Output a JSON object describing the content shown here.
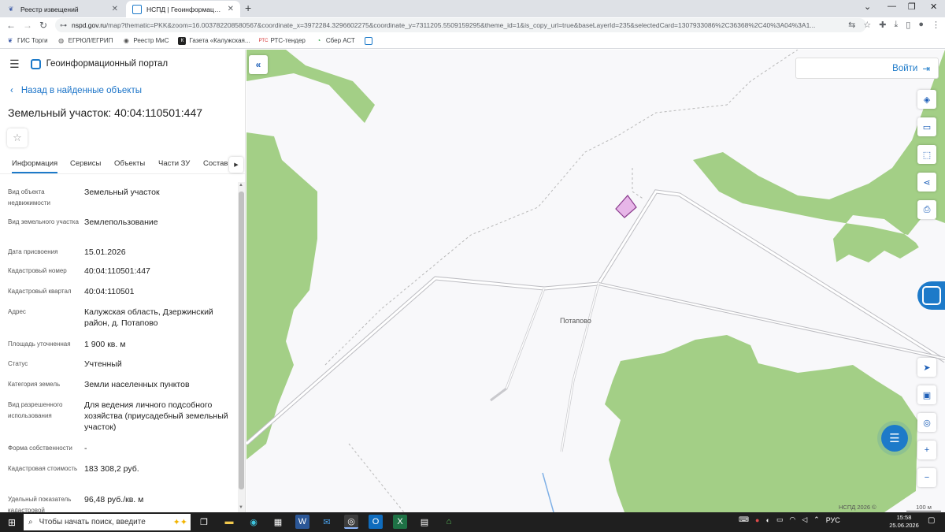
{
  "browser": {
    "tabs": [
      {
        "title": "Реестр извещений",
        "active": false
      },
      {
        "title": "НСПД | Геоинформационный п",
        "active": true
      }
    ],
    "url_host": "nspd.gov.ru",
    "url_path": "/map?thematic=PKK&zoom=16.003782208580567&coordinate_x=3972284.3296602275&coordinate_y=7311205.5509159295&theme_id=1&is_copy_url=true&baseLayerId=235&selectedCard=1307933086%2C36368%2C40%3A04%3A1...",
    "bookmarks": [
      {
        "label": "ГИС Торги",
        "icon": "gis-torgi-icon"
      },
      {
        "label": "ЕГРЮЛ/ЕГРИП",
        "icon": "egrul-icon"
      },
      {
        "label": "Реестр МиС",
        "icon": "registry-icon"
      },
      {
        "label": "Газета «Калужская...",
        "icon": "newspaper-icon"
      },
      {
        "label": "РТС-тендер",
        "icon": "rts-icon"
      },
      {
        "label": "Сбер АСТ",
        "icon": "sber-icon"
      }
    ]
  },
  "panel": {
    "portal_title": "Геоинформационный портал",
    "back_label": "Назад в найденные объекты",
    "title": "Земельный участок: 40:04:110501:447",
    "tabs": [
      "Информация",
      "Сервисы",
      "Объекты",
      "Части ЗУ",
      "Состав"
    ],
    "properties": [
      {
        "label": "Вид объекта недвижимости",
        "value": "Земельный участок"
      },
      {
        "label": "Вид земельного участка",
        "value": "Землепользование"
      },
      {
        "label": "Дата присвоения",
        "value": "15.01.2026"
      },
      {
        "label": "Кадастровый номер",
        "value": "40:04:110501:447"
      },
      {
        "label": "Кадастровый квартал",
        "value": "40:04:110501"
      },
      {
        "label": "Адрес",
        "value": "Калужская область, Дзержинский район, д. Потапово"
      },
      {
        "label": "Площадь уточненная",
        "value": "1 900 кв. м"
      },
      {
        "label": "Статус",
        "value": "Учтенный"
      },
      {
        "label": "Категория земель",
        "value": "Земли населенных пунктов"
      },
      {
        "label": "Вид разрешенного использования",
        "value": "Для ведения личного подсобного хозяйства (приусадебный земельный участок)"
      },
      {
        "label": "Форма собственности",
        "value": "-"
      },
      {
        "label": "Кадастровая стоимость",
        "value": "183 308,2 руб."
      },
      {
        "label": "Удельный показатель кадастровой",
        "value": "96,48 руб./кв. м"
      }
    ]
  },
  "map": {
    "login_label": "Войти",
    "place_label": "Потапово",
    "attribution": "НСПД 2026 ©",
    "scale_label": "100 м",
    "colors": {
      "forest": "#a3cf86",
      "parcel_fill": "#e7b6e8",
      "parcel_stroke": "#8b3c8e",
      "accent": "#1d7ac9"
    }
  },
  "taskbar": {
    "search_placeholder": "Чтобы начать поиск, введите",
    "language": "РУС",
    "time": "15:58",
    "date": "25.06.2026"
  }
}
